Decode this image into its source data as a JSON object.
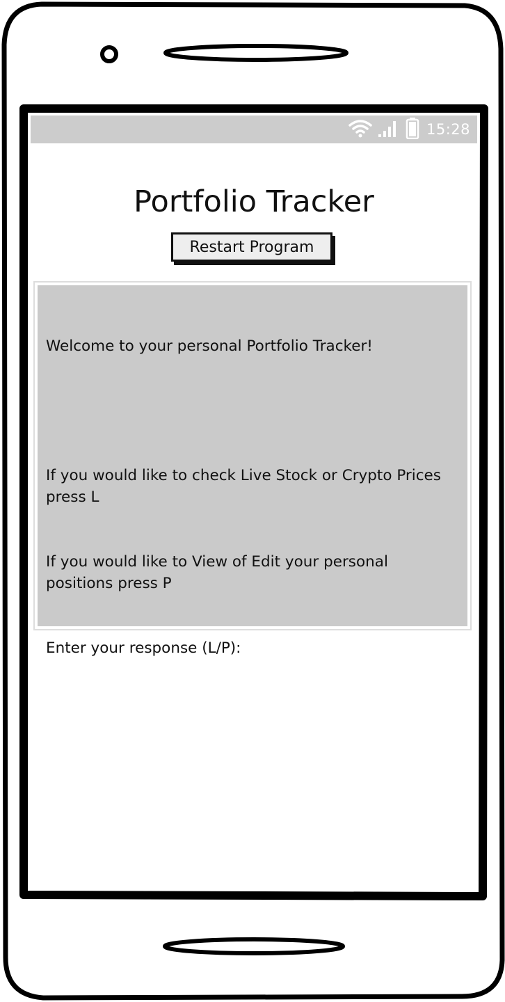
{
  "status_bar": {
    "time": "15:28",
    "icons": [
      "wifi-icon",
      "signal-icon",
      "battery-icon"
    ],
    "background_color": "#cccccc"
  },
  "app": {
    "title": "Portfolio Tracker",
    "restart_button_label": "Restart Program"
  },
  "console": {
    "lines": [
      "Welcome to your personal Portfolio Tracker!",
      "",
      "If you would like to check Live Stock or Crypto Prices press L",
      "If you would like to View of Edit your personal positions press P",
      "Enter your response (L/P):"
    ],
    "background_color": "#cacaca"
  }
}
